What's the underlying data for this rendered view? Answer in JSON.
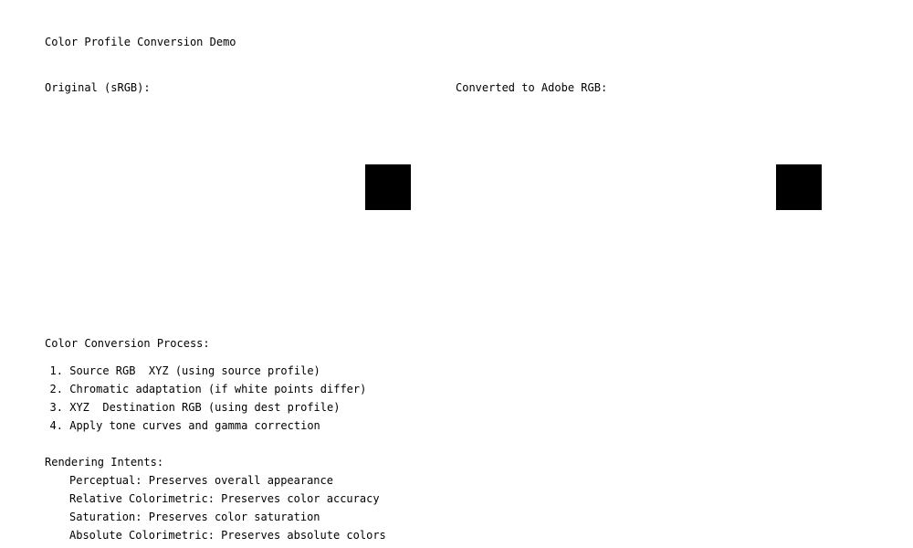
{
  "title": "Color Profile Conversion Demo",
  "original": {
    "label": "Original (sRGB):",
    "swatch_color": "#000000"
  },
  "converted": {
    "label": "Converted to Adobe RGB:",
    "swatch_color": "#000000"
  },
  "process": {
    "heading": "Color Conversion Process:",
    "steps": [
      {
        "num": "1.",
        "text": "Source RGB  XYZ (using source profile)"
      },
      {
        "num": "2.",
        "text": "Chromatic adaptation (if white points differ)"
      },
      {
        "num": "3.",
        "text": "XYZ  Destination RGB (using dest profile)"
      },
      {
        "num": "4.",
        "text": "Apply tone curves and gamma correction"
      }
    ]
  },
  "intents": {
    "heading": "Rendering Intents:",
    "items": [
      "Perceptual: Preserves overall appearance",
      "Relative Colorimetric: Preserves color accuracy",
      "Saturation: Preserves color saturation",
      "Absolute Colorimetric: Preserves absolute colors"
    ]
  }
}
